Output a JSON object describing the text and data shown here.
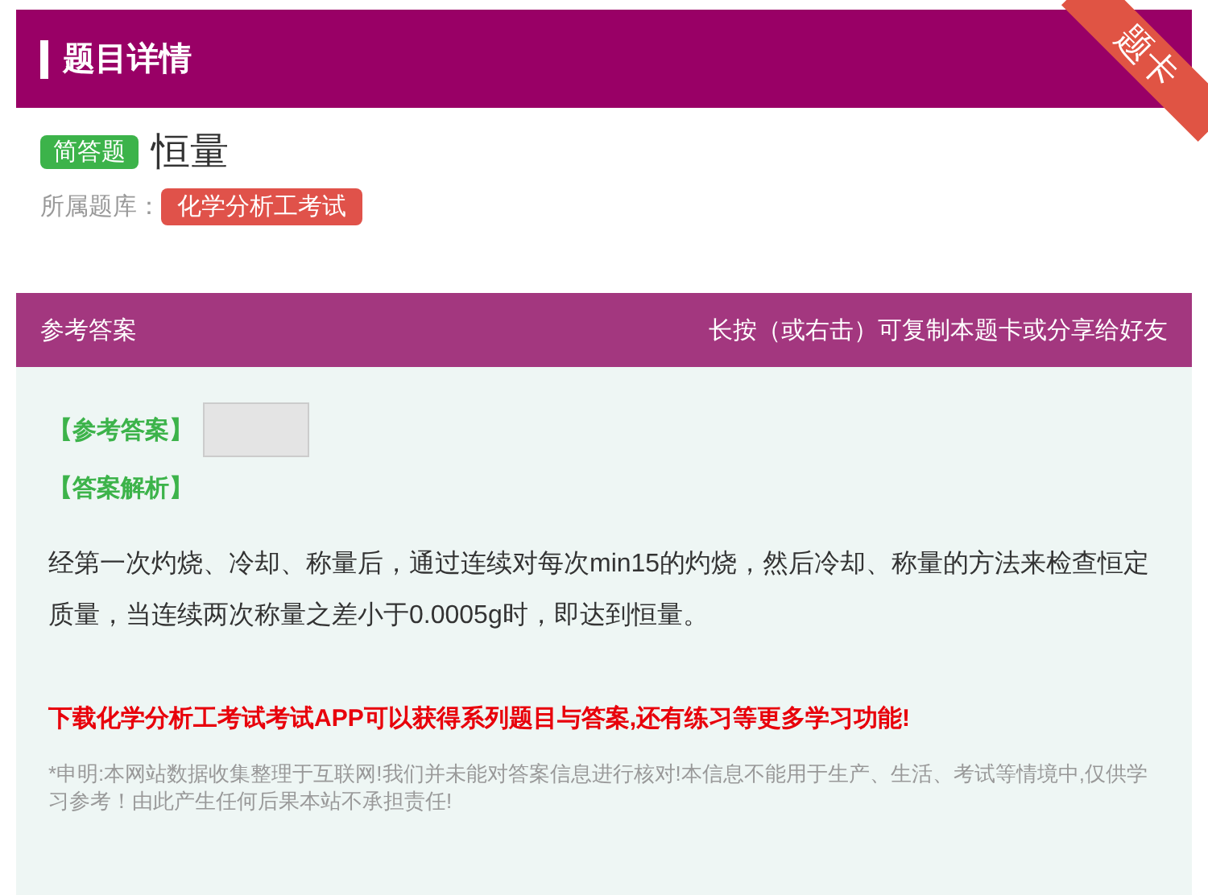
{
  "header": {
    "title": "题目详情",
    "ribbon": "题卡"
  },
  "question": {
    "type_badge": "简答题",
    "title": "恒量",
    "library_label": "所属题库：",
    "library": "化学分析工考试"
  },
  "answer_section": {
    "title": "参考答案",
    "hint": "长按（或右击）可复制本题卡或分享给好友",
    "answer_label": "【参考答案】",
    "analysis_label": "【答案解析】",
    "analysis": "经第一次灼烧、冷却、称量后，通过连续对每次min15的灼烧，然后冷却、称量的方法来检查恒定质量，当连续两次称量之差小于0.0005g时，即达到恒量。",
    "promo": "下载化学分析工考试考试APP可以获得系列题目与答案,还有练习等更多学习功能!",
    "disclaimer": "*申明:本网站数据收集整理于互联网!我们并未能对答案信息进行核对!本信息不能用于生产、生活、考试等情境中,仅供学习参考！由此产生任何后果本站不承担责任!"
  }
}
